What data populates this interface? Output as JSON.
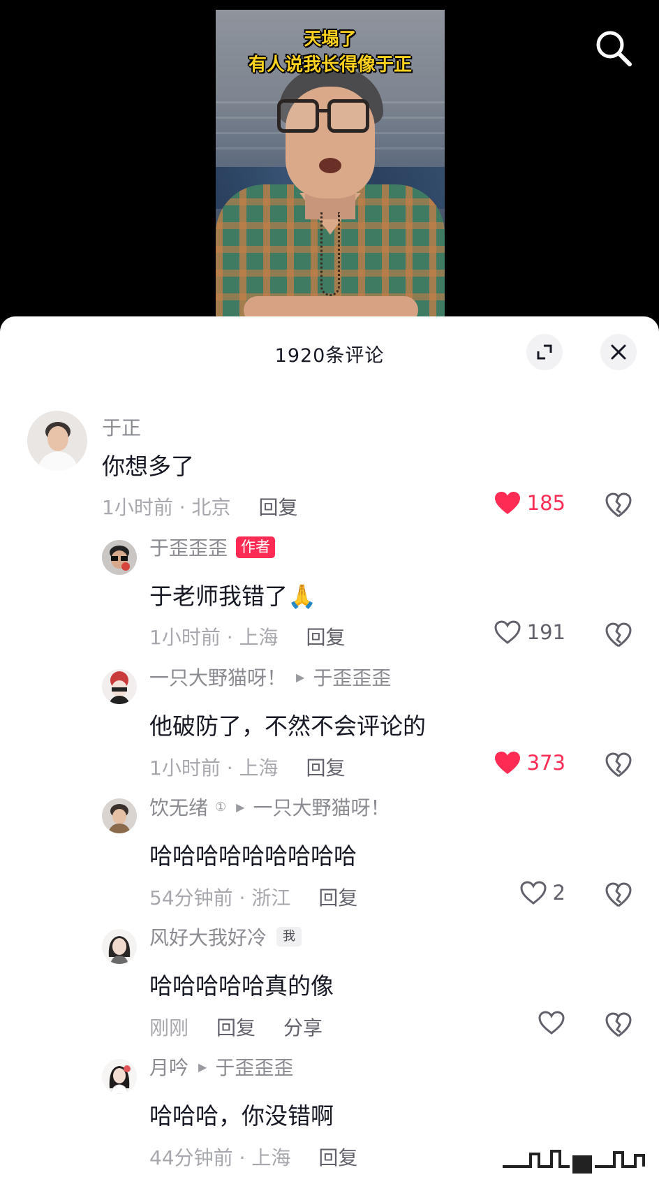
{
  "video": {
    "caption_line1": "天塌了",
    "caption_line2": "有人说我长得像于正"
  },
  "sheet": {
    "title": "1920条评论"
  },
  "comments": [
    {
      "name": "于正",
      "text": "你想多了",
      "time_location": "1小时前 · 北京",
      "reply": "回复",
      "likes": "185",
      "liked": true
    },
    {
      "name": "于歪歪歪",
      "tag": "作者",
      "text": "于老师我错了🙏",
      "time_location": "1小时前 · 上海",
      "reply": "回复",
      "likes": "191",
      "liked": false
    },
    {
      "name": "一只大野猫呀！",
      "reply_to": "于歪歪歪",
      "text": "他破防了，不然不会评论的",
      "time_location": "1小时前 · 上海",
      "reply": "回复",
      "likes": "373",
      "liked": true
    },
    {
      "name": "饮无绪",
      "badge": "①",
      "reply_to": "一只大野猫呀！",
      "text": "哈哈哈哈哈哈哈哈哈",
      "time_location": "54分钟前 · 浙江",
      "reply": "回复",
      "likes": "2",
      "liked": false
    },
    {
      "name": "风好大我好冷",
      "tag": "我",
      "text": "哈哈哈哈哈真的像",
      "time_location": "刚刚",
      "reply": "回复",
      "share": "分享",
      "likes": "",
      "liked": false
    },
    {
      "name": "月吟",
      "reply_to": "于歪歪歪",
      "text": "哈哈哈，你没错啊",
      "time_location": "44分钟前 · 上海",
      "reply": "回复"
    }
  ],
  "colors": {
    "accent": "#fe2c55",
    "text": "#161823",
    "secondary": "#8a8b91",
    "caption": "#ffd21f"
  },
  "icons": [
    "search-icon",
    "expand-icon",
    "close-icon",
    "heart-icon",
    "dislike-icon",
    "play-arrow-icon"
  ]
}
